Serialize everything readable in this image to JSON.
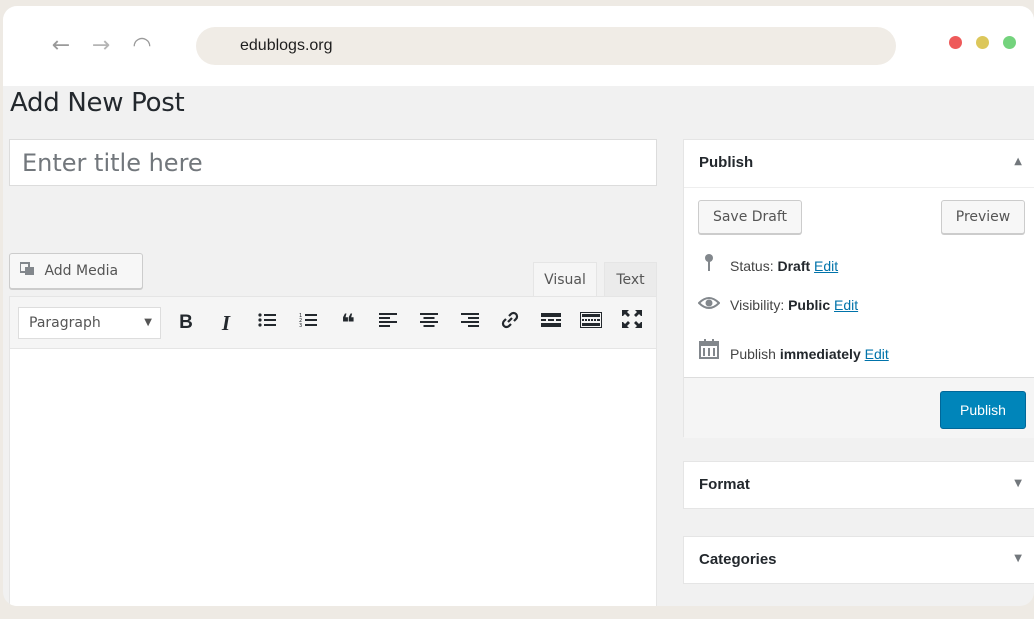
{
  "browser": {
    "url": "edublogs.org",
    "nav": {
      "back_icon": "←",
      "forward_icon": "→",
      "reload_icon": "◠"
    },
    "window_dots": [
      "#ee5a5a",
      "#dcc75b",
      "#74d37d"
    ]
  },
  "page": {
    "title": "Add New Post",
    "title_placeholder": "Enter title here"
  },
  "editor": {
    "add_media_label": "Add Media",
    "add_media_icon": "media-icon",
    "tabs": {
      "visual": "Visual",
      "text": "Text"
    },
    "format_select": "Paragraph",
    "toolbar": {
      "bold": "B",
      "italic": "I",
      "bullet_list": "☰",
      "numbered_list": "☷",
      "blockquote": "❝",
      "align_left": "≡",
      "align_center": "≡",
      "align_right": "≡",
      "link": "🔗",
      "read_more": "▬",
      "toolbar_toggle": "▦",
      "fullscreen": "⤧"
    }
  },
  "publish_box": {
    "title": "Publish",
    "toggle_icon": "▲",
    "save_draft": "Save Draft",
    "preview": "Preview",
    "status_label": "Status:",
    "status_value": "Draft",
    "visibility_label": "Visibility:",
    "visibility_value": "Public",
    "publish_label": "Publish",
    "publish_value": "immediately",
    "edit_link": "Edit",
    "publish_button": "Publish",
    "accent_color": "#0085ba"
  },
  "format_box": {
    "title": "Format",
    "toggle_icon": "▼"
  },
  "categories_box": {
    "title": "Categories",
    "toggle_icon": "▼"
  }
}
